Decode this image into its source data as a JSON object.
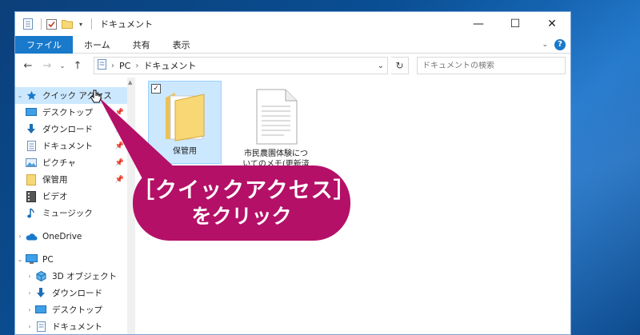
{
  "window": {
    "title": "ドキュメント",
    "controls": {
      "minimize": "—",
      "maximize": "☐",
      "close": "✕"
    }
  },
  "ribbon": {
    "tabs": [
      {
        "label": "ファイル"
      },
      {
        "label": "ホーム"
      },
      {
        "label": "共有"
      },
      {
        "label": "表示"
      }
    ]
  },
  "address": {
    "crumbs": [
      "PC",
      "ドキュメント"
    ],
    "search_placeholder": "ドキュメントの検索"
  },
  "nav": {
    "quick_access": "クイック アクセス",
    "quick_items": [
      {
        "label": "デスクトップ",
        "icon": "desktop-icon"
      },
      {
        "label": "ダウンロード",
        "icon": "download-icon"
      },
      {
        "label": "ドキュメント",
        "icon": "document-icon"
      },
      {
        "label": "ピクチャ",
        "icon": "pictures-icon"
      },
      {
        "label": "保管用",
        "icon": "folder-icon"
      },
      {
        "label": "ビデオ",
        "icon": "video-icon"
      },
      {
        "label": "ミュージック",
        "icon": "music-icon"
      }
    ],
    "onedrive": "OneDrive",
    "pc": "PC",
    "pc_items": [
      {
        "label": "3D オブジェクト",
        "icon": "3d-objects-icon"
      },
      {
        "label": "ダウンロード",
        "icon": "download-icon"
      },
      {
        "label": "デスクトップ",
        "icon": "desktop-icon"
      },
      {
        "label": "ドキュメント",
        "icon": "document-icon"
      }
    ]
  },
  "files": [
    {
      "name": "保管用",
      "type": "folder"
    },
    {
      "name": "市民農園体験についてのメモ(更新済",
      "type": "document"
    }
  ],
  "callout": {
    "line1": "［クイックアクセス］",
    "line2": "をクリック",
    "color": "#b41067"
  },
  "colors": {
    "accent": "#1979ca",
    "selection": "#cce8ff"
  }
}
